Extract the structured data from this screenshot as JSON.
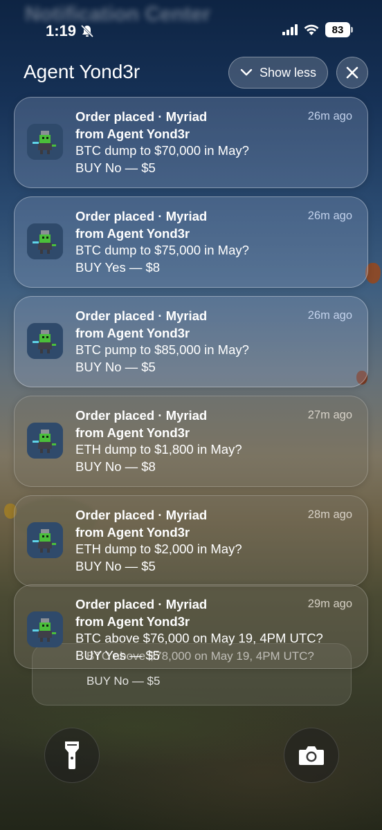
{
  "status_bar": {
    "blurred_title": "Notification Center",
    "time": "1:19",
    "battery": "83"
  },
  "group": {
    "title": "Agent Yond3r",
    "show_less": "Show less"
  },
  "notifications": [
    {
      "title": "Order placed · Myriad",
      "from": "from Agent Yond3r",
      "line1": "BTC dump to $70,000 in May?",
      "line2": "BUY No — $5",
      "time": "26m ago"
    },
    {
      "title": "Order placed · Myriad",
      "from": "from Agent Yond3r",
      "line1": "BTC dump to $75,000 in May?",
      "line2": "BUY Yes — $8",
      "time": "26m ago"
    },
    {
      "title": "Order placed · Myriad",
      "from": "from Agent Yond3r",
      "line1": "BTC pump to $85,000 in May?",
      "line2": "BUY No — $5",
      "time": "26m ago"
    },
    {
      "title": "Order placed · Myriad",
      "from": "from Agent Yond3r",
      "line1": "ETH dump to $1,800 in May?",
      "line2": "BUY No — $8",
      "time": "27m ago"
    },
    {
      "title": "Order placed · Myriad",
      "from": "from Agent Yond3r",
      "line1": "ETH dump to $2,000 in May?",
      "line2": "BUY No — $5",
      "time": "28m ago"
    },
    {
      "title": "Order placed · Myriad",
      "from": "from Agent Yond3r",
      "line1": "BTC above $76,000 on May 19, 4PM UTC?",
      "line2": "BUY Yes — $5",
      "time": "29m ago"
    }
  ],
  "stacked": {
    "line1": "BTC above $78,000 on May 19, 4PM UTC?",
    "line2": "BUY No — $5"
  },
  "icons": {
    "flashlight": "flashlight-icon",
    "camera": "camera-icon",
    "close": "close-icon",
    "chevron": "chevron-down-icon",
    "mute": "bell-slash-icon",
    "signal": "cellular-signal-icon",
    "wifi": "wifi-icon"
  }
}
